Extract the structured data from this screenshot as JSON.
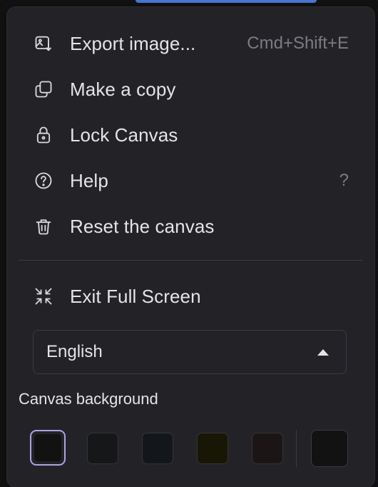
{
  "menu": {
    "items": [
      {
        "label": "Export image...",
        "shortcut": "Cmd+Shift+E",
        "icon": "export-image-icon"
      },
      {
        "label": "Make a copy",
        "shortcut": "",
        "icon": "copy-icon"
      },
      {
        "label": "Lock Canvas",
        "shortcut": "",
        "icon": "lock-icon"
      },
      {
        "label": "Help",
        "shortcut": "?",
        "icon": "help-icon"
      },
      {
        "label": "Reset the canvas",
        "shortcut": "",
        "icon": "trash-icon"
      }
    ],
    "fullscreen": {
      "label": "Exit Full Screen",
      "icon": "exit-fullscreen-icon"
    }
  },
  "language": {
    "selected": "English"
  },
  "canvas_background": {
    "title": "Canvas background",
    "colors": [
      "#121212",
      "#161718",
      "#13171c",
      "#181605",
      "#1b1615"
    ],
    "selected_index": 0,
    "custom_color": "#121212"
  },
  "theme": {
    "accent": "#a9a4e4",
    "menu_bg": "#232327",
    "text": "#e4e4e8",
    "muted": "#7b7b82"
  }
}
